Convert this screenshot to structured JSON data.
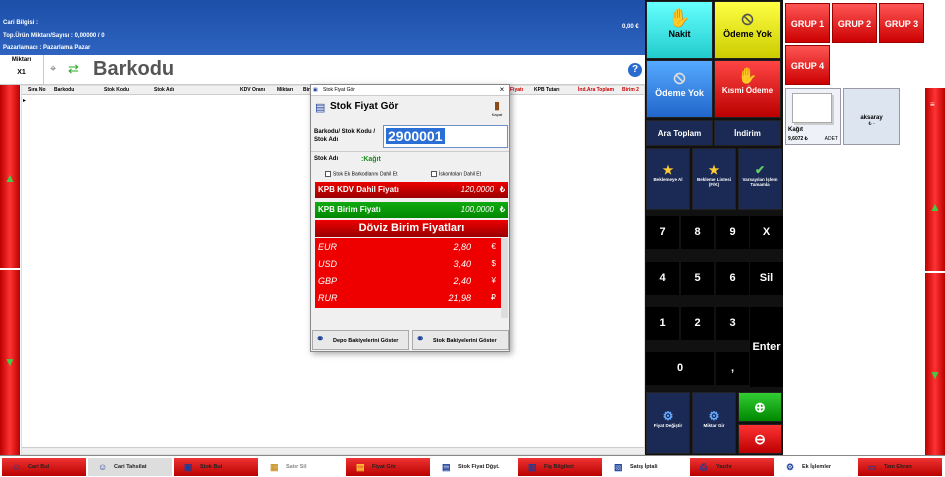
{
  "header": {
    "cari_bilgisi": "Cari Bilgisi :",
    "top_urun": "Top.Ürün Miktarı/Sayısı : 0,00000 / 0",
    "pazarlamaci": "Pazarlamacı : Pazarlama Pazar",
    "amount": "0,00 €"
  },
  "barcode_row": {
    "miktar_label": "Miktarı",
    "miktar_value": "X1",
    "title": "Barkodu",
    "help": "?"
  },
  "grid": {
    "columns": [
      "Sıra No",
      "Barkodu",
      "Stok Kodu",
      "Stok Adı",
      "KDV Oranı",
      "Miktarı",
      "Bir",
      "Fiyatı",
      "KPB Tutarı",
      "İnd.Ara Toplam",
      "Birim 2"
    ]
  },
  "dialog": {
    "window_title": "Stok Fiyat Gör",
    "heading": "Stok Fiyat Gör",
    "kapat": "Kapat",
    "barkod_label": "Barkodu/ Stok Kodu / Stok Adı",
    "barkod_value": "2900001",
    "stok_adi_label": "Stok Adı",
    "stok_adi_value": ":Kağıt",
    "chk_ek_barkod": "Stok Ek Barkodlarını Dahil Et",
    "chk_iskonto": "İskontoları Dahil Et",
    "kpb_kdv_label": "KPB KDV Dahil Fiyatı",
    "kpb_kdv_value": "120,0000",
    "kpb_kdv_sym": "₺",
    "kpb_birim_label": "KPB Birim Fiyatı",
    "kpb_birim_value": "100,0000",
    "kpb_birim_sym": "₺",
    "doviz_title": "Döviz Birim Fiyatları",
    "currencies": [
      {
        "code": "EUR",
        "value": "2,80",
        "sym": "€"
      },
      {
        "code": "USD",
        "value": "3,40",
        "sym": "$"
      },
      {
        "code": "GBP",
        "value": "2,40",
        "sym": "¥"
      },
      {
        "code": "RUR",
        "value": "21,98",
        "sym": "₽"
      }
    ],
    "btn_depo": "Depo Bakiyelerini Göster",
    "btn_stok": "Stok Bakiyelerini Göster"
  },
  "payment": {
    "nakit": "Nakit",
    "odeme_yok1": "Ödeme Yok",
    "odeme_yok2": "Ödeme Yok",
    "kismi_odeme": "Kısmi Ödeme",
    "ara_toplam": "Ara Toplam",
    "indirim": "İndirim",
    "beklemeye_al": "Beklemeye Al",
    "bekleme_listesi": "Bekleme Listesi (F/K)",
    "varsayilan_islem": "Varsayılan İşlem Tamamla",
    "fiyat_degistir": "Fiyat Değiştir",
    "miktar_gir": "Miktar Gir"
  },
  "keypad": {
    "row1": [
      "7",
      "8",
      "9",
      "X"
    ],
    "row2": [
      "4",
      "5",
      "6",
      "Sil"
    ],
    "row3": [
      "1",
      "2",
      "3"
    ],
    "zero": "0",
    "comma": ",",
    "enter": "Enter"
  },
  "groups": [
    "GRUP 1",
    "GRUP 2",
    "GRUP 3",
    "GRUP 4"
  ],
  "products": [
    {
      "name": "Kağıt",
      "price": "9,6072 ₺",
      "unit": "ADET"
    },
    {
      "name": "aksaray",
      "price": "₺ -"
    }
  ],
  "bottom": [
    "Cari Bul",
    "Cari Tahsilat",
    "Stok Bul",
    "Satır Sil",
    "Fiyat Gör",
    "Stok Fiyat Dğşt.",
    "Fiş Bilgileri",
    "Satış İptali",
    "Yazdır",
    "Ek İşlemler",
    "Tam Ekran"
  ]
}
